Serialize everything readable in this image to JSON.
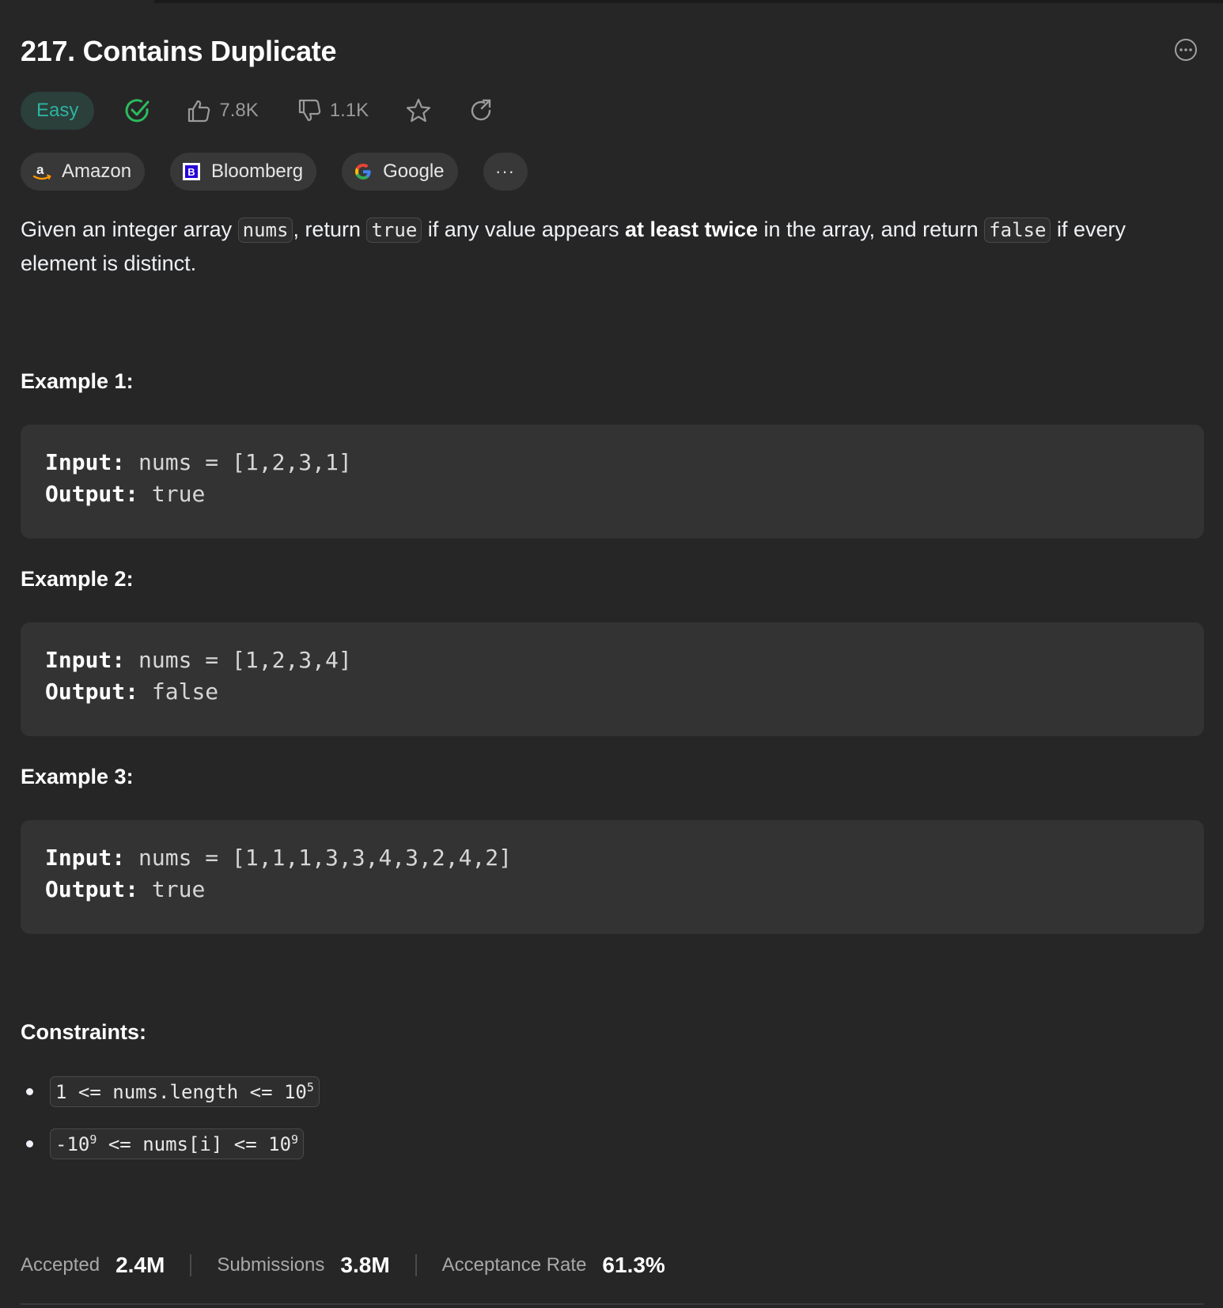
{
  "problem": {
    "title": "217. Contains Duplicate",
    "difficulty": "Easy",
    "likes": "7.8K",
    "dislikes": "1.1K"
  },
  "companies": [
    {
      "name": "Amazon",
      "icon": "amazon-logo"
    },
    {
      "name": "Bloomberg",
      "icon": "bloomberg-logo"
    },
    {
      "name": "Google",
      "icon": "google-logo"
    }
  ],
  "more_companies_label": "···",
  "description": {
    "p1": "Given an integer array ",
    "code1": "nums",
    "p2": ", return ",
    "code2": "true",
    "p3": " if any value appears ",
    "bold": "at least twice",
    "p4": " in the array, and return ",
    "code3": "false",
    "p5": " if every element is distinct."
  },
  "examples": [
    {
      "heading": "Example 1:",
      "input_label": "Input:",
      "input": "nums = [1,2,3,1]",
      "output_label": "Output:",
      "output": "true"
    },
    {
      "heading": "Example 2:",
      "input_label": "Input:",
      "input": "nums = [1,2,3,4]",
      "output_label": "Output:",
      "output": "false"
    },
    {
      "heading": "Example 3:",
      "input_label": "Input:",
      "input": "nums = [1,1,1,3,3,4,3,2,4,2]",
      "output_label": "Output:",
      "output": "true"
    }
  ],
  "constraints": {
    "heading": "Constraints:",
    "c1": {
      "text": "1 <= nums.length <= 10",
      "sup": "5"
    },
    "c2": {
      "pre": "-10",
      "pre_sup": "9",
      "mid": " <= nums[i] <= 10",
      "sup": "9"
    }
  },
  "stats": {
    "accepted_label": "Accepted",
    "accepted": "2.4M",
    "submissions_label": "Submissions",
    "submissions": "3.8M",
    "rate_label": "Acceptance Rate",
    "rate": "61.3%"
  },
  "colors": {
    "background": "#262626",
    "easy": "#2db3a0",
    "solved_check": "#2cbb5d"
  }
}
